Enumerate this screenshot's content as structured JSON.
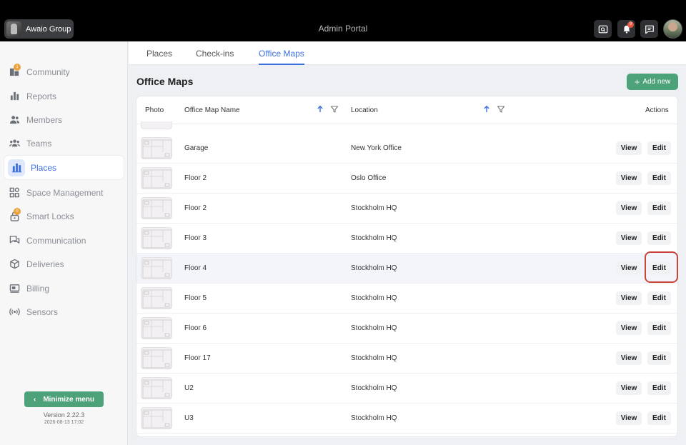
{
  "topbar": {
    "org_name": "Awaio Group",
    "portal_title": "Admin Portal",
    "notification_count": "9"
  },
  "sidebar": {
    "items": [
      {
        "label": "Community",
        "icon": "community-icon",
        "badge": "1"
      },
      {
        "label": "Reports",
        "icon": "bar-chart-icon"
      },
      {
        "label": "Members",
        "icon": "members-icon"
      },
      {
        "label": "Teams",
        "icon": "teams-icon"
      },
      {
        "label": "Places",
        "icon": "building-icon",
        "active": true
      },
      {
        "label": "Space Management",
        "icon": "grid-icon"
      },
      {
        "label": "Smart Locks",
        "icon": "lock-icon",
        "badge": "0"
      },
      {
        "label": "Communication",
        "icon": "chat-icon"
      },
      {
        "label": "Deliveries",
        "icon": "package-icon"
      },
      {
        "label": "Billing",
        "icon": "billing-icon"
      },
      {
        "label": "Sensors",
        "icon": "sensor-icon"
      }
    ],
    "minimize_label": "Minimize menu",
    "version": "Version 2.22.3",
    "build": "2026-08-13 17:02"
  },
  "tabs": [
    {
      "label": "Places"
    },
    {
      "label": "Check-ins"
    },
    {
      "label": "Office Maps",
      "active": true
    }
  ],
  "page": {
    "title": "Office Maps",
    "add_label": "Add new"
  },
  "table": {
    "headers": {
      "photo": "Photo",
      "name": "Office Map Name",
      "location": "Location",
      "actions": "Actions"
    },
    "view_label": "View",
    "edit_label": "Edit",
    "rows": [
      {
        "name": "Garage",
        "location": "New York Office"
      },
      {
        "name": "Floor 2",
        "location": "Oslo Office"
      },
      {
        "name": "Floor 2",
        "location": "Stockholm HQ"
      },
      {
        "name": "Floor 3",
        "location": "Stockholm HQ"
      },
      {
        "name": "Floor 4",
        "location": "Stockholm HQ",
        "highlighted": true
      },
      {
        "name": "Floor 5",
        "location": "Stockholm HQ"
      },
      {
        "name": "Floor 6",
        "location": "Stockholm HQ"
      },
      {
        "name": "Floor 17",
        "location": "Stockholm HQ"
      },
      {
        "name": "U2",
        "location": "Stockholm HQ"
      },
      {
        "name": "U3",
        "location": "Stockholm HQ"
      }
    ]
  },
  "colors": {
    "accent": "#3c6fe0",
    "primary_button": "#4ea27a",
    "highlight_ring": "#c9453a"
  }
}
